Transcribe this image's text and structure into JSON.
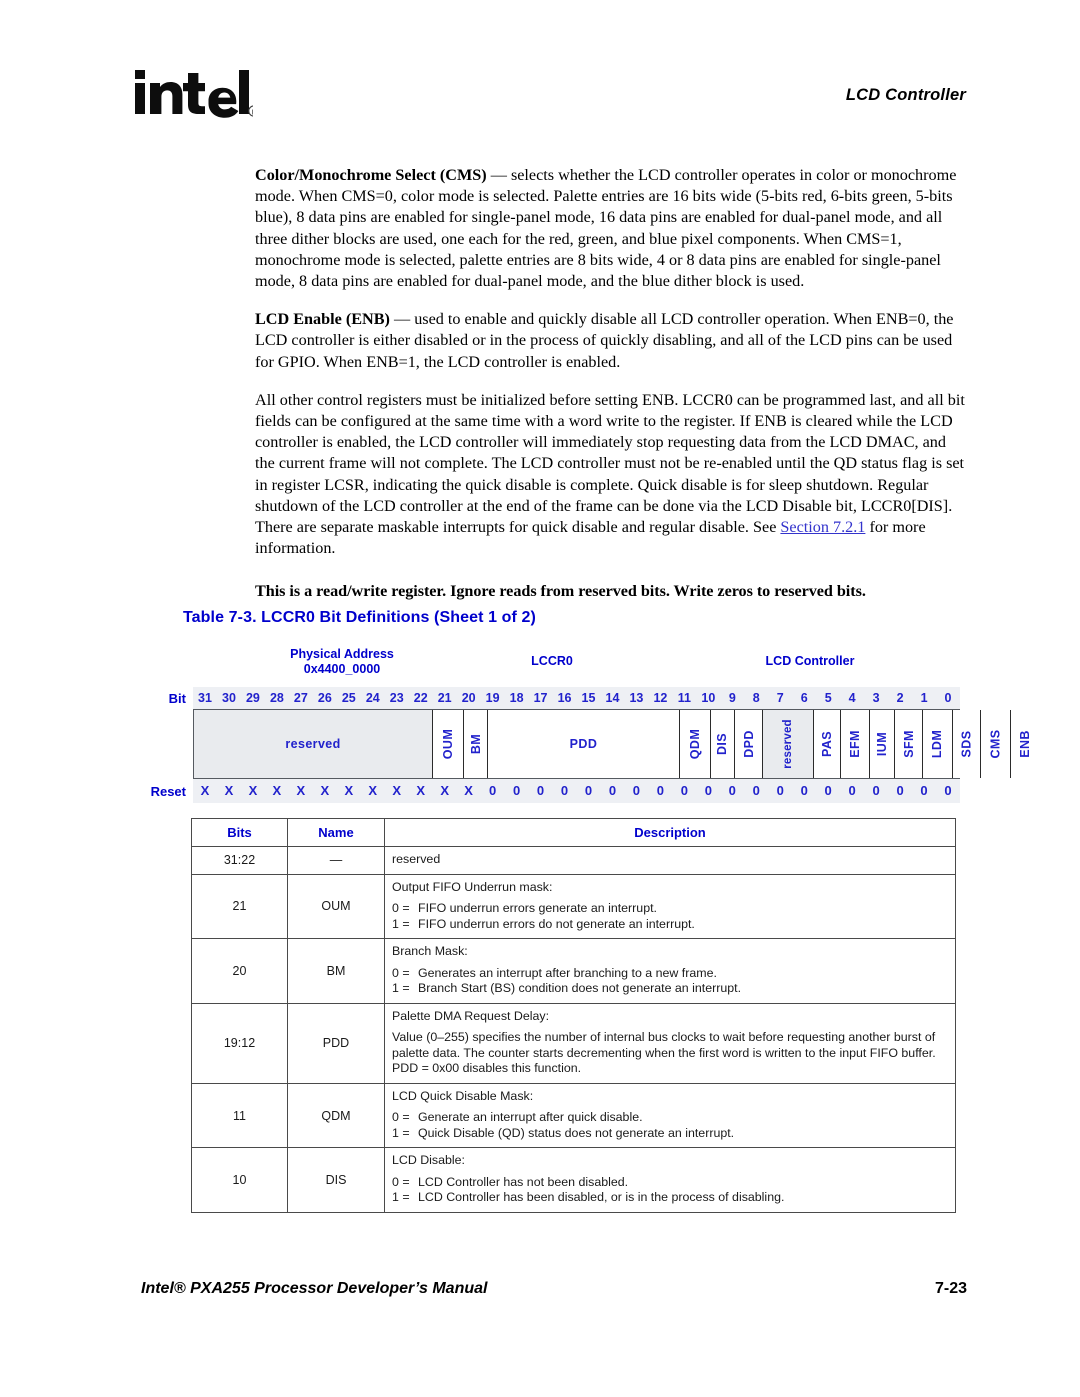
{
  "header": {
    "logo_text": "intel",
    "logo_mark": "registered-trademark",
    "chapter_title": "LCD Controller"
  },
  "body": {
    "paragraphs": [
      {
        "lead": "Color/Monochrome Select (CMS)",
        "text": " — selects whether the LCD controller operates in color or monochrome mode. When CMS=0, color mode is selected. Palette entries are 16 bits wide (5-bits red, 6-bits green, 5-bits blue), 8 data pins are enabled for single-panel mode, 16 data pins are enabled for dual-panel mode, and all three dither blocks are used, one each for the red, green, and blue pixel components. When CMS=1, monochrome mode is selected, palette entries are 8 bits wide, 4 or 8 data pins are enabled for single-panel mode, 8 data pins are enabled for dual-panel mode, and the blue dither block is used."
      },
      {
        "lead": "LCD Enable (ENB)",
        "text": " — used to enable and quickly disable all LCD controller operation. When ENB=0, the LCD controller is either disabled or in the process of quickly disabling, and all of the LCD pins can be used for GPIO. When ENB=1, the LCD controller is enabled."
      }
    ],
    "paragraph3_part1": "All other control registers must be initialized before setting ENB. LCCR0 can be programmed last, and all bit fields can be configured at the same time with a word write to the register. If ENB is cleared while the LCD controller is enabled, the LCD controller will immediately stop requesting data from the LCD DMAC, and the current frame will not complete. The LCD controller must not be re-enabled until the QD status flag is set in register LCSR, indicating the quick disable is complete. Quick disable is for sleep shutdown. Regular shutdown of the LCD controller at the end of the frame can be done via the LCD Disable bit, LCCR0[DIS]. There are separate maskable interrupts for quick disable and regular disable. See ",
    "paragraph3_link": "Section 7.2.1",
    "paragraph3_part2": " for more information.",
    "note": "This is a read/write register. Ignore reads from reserved bits. Write zeros to reserved bits."
  },
  "table_caption": "Table 7-3. LCCR0 Bit Definitions (Sheet 1 of 2)",
  "register": {
    "physical_address_label": "Physical Address",
    "physical_address_value": "0x4400_0000",
    "register_name": "LCCR0",
    "unit_name": "LCD Controller",
    "bit_label": "Bit",
    "reset_label": "Reset",
    "bit_numbers": [
      "31",
      "30",
      "29",
      "28",
      "27",
      "26",
      "25",
      "24",
      "23",
      "22",
      "21",
      "20",
      "19",
      "18",
      "17",
      "16",
      "15",
      "14",
      "13",
      "12",
      "11",
      "10",
      "9",
      "8",
      "7",
      "6",
      "5",
      "4",
      "3",
      "2",
      "1",
      "0"
    ],
    "reset_values": [
      "X",
      "X",
      "X",
      "X",
      "X",
      "X",
      "X",
      "X",
      "X",
      "X",
      "X",
      "X",
      "0",
      "0",
      "0",
      "0",
      "0",
      "0",
      "0",
      "0",
      "0",
      "0",
      "0",
      "0",
      "0",
      "0",
      "0",
      "0",
      "0",
      "0",
      "0",
      "0"
    ],
    "fields": [
      {
        "label": "reserved",
        "span": 10,
        "orientation": "horizontal",
        "shaded": true
      },
      {
        "label": "OUM",
        "span": 1,
        "orientation": "vertical",
        "shaded": false
      },
      {
        "label": "BM",
        "span": 1,
        "orientation": "vertical",
        "shaded": false
      },
      {
        "label": "PDD",
        "span": 8,
        "orientation": "horizontal",
        "shaded": false
      },
      {
        "label": "QDM",
        "span": 1,
        "orientation": "vertical",
        "shaded": false
      },
      {
        "label": "DIS",
        "span": 1,
        "orientation": "vertical",
        "shaded": false
      },
      {
        "label": "DPD",
        "span": 1,
        "orientation": "vertical",
        "shaded": false
      },
      {
        "label": "reserved",
        "span": 1,
        "orientation": "vertical",
        "shaded": true
      },
      {
        "label": "PAS",
        "span": 1,
        "orientation": "vertical",
        "shaded": false
      },
      {
        "label": "EFM",
        "span": 1,
        "orientation": "vertical",
        "shaded": false
      },
      {
        "label": "IUM",
        "span": 1,
        "orientation": "vertical",
        "shaded": false
      },
      {
        "label": "SFM",
        "span": 1,
        "orientation": "vertical",
        "shaded": false
      },
      {
        "label": "LDM",
        "span": 1,
        "orientation": "vertical",
        "shaded": false
      },
      {
        "label": "SDS",
        "span": 1,
        "orientation": "vertical",
        "shaded": false
      },
      {
        "label": "CMS",
        "span": 1,
        "orientation": "vertical",
        "shaded": false
      },
      {
        "label": "ENB",
        "span": 1,
        "orientation": "vertical",
        "shaded": false
      }
    ]
  },
  "bit_table": {
    "headers": [
      "Bits",
      "Name",
      "Description"
    ],
    "rows": [
      {
        "bits": "31:22",
        "name": "—",
        "title": "reserved",
        "lines": [],
        "paragraph": ""
      },
      {
        "bits": "21",
        "name": "OUM",
        "title": "Output FIFO Underrun mask:",
        "lines": [
          {
            "k": "0 =",
            "v": "FIFO underrun errors generate an interrupt."
          },
          {
            "k": "1 =",
            "v": "FIFO underrun errors do not generate an interrupt."
          }
        ],
        "paragraph": ""
      },
      {
        "bits": "20",
        "name": "BM",
        "title": "Branch Mask:",
        "lines": [
          {
            "k": "0 =",
            "v": "Generates an interrupt after branching to a new frame."
          },
          {
            "k": "1 =",
            "v": "Branch Start (BS) condition does not generate an interrupt."
          }
        ],
        "paragraph": ""
      },
      {
        "bits": "19:12",
        "name": "PDD",
        "title": "Palette DMA Request Delay:",
        "lines": [],
        "paragraph": "Value (0–255) specifies the number of internal bus clocks to wait before requesting another burst of palette data. The counter starts decrementing when the first word is written to the input FIFO buffer. PDD = 0x00 disables this function."
      },
      {
        "bits": "11",
        "name": "QDM",
        "title": "LCD Quick Disable Mask:",
        "lines": [
          {
            "k": "0 =",
            "v": "Generate an interrupt after quick disable."
          },
          {
            "k": "1 =",
            "v": "Quick Disable (QD) status does not generate an interrupt."
          }
        ],
        "paragraph": ""
      },
      {
        "bits": "10",
        "name": "DIS",
        "title": "LCD Disable:",
        "lines": [
          {
            "k": "0 =",
            "v": "LCD Controller has not been disabled."
          },
          {
            "k": "1 =",
            "v": "LCD Controller has been disabled, or is in the process of disabling."
          }
        ],
        "paragraph": ""
      }
    ]
  },
  "footer": {
    "left": "Intel® PXA255 Processor Developer’s Manual",
    "right": "7-23"
  },
  "colors": {
    "heading_blue": "#0000cc",
    "link_blue": "#3333cc",
    "register_shade": "#e9ebee",
    "register_strip": "#eef0f4",
    "rule": "#4a4a4a"
  }
}
